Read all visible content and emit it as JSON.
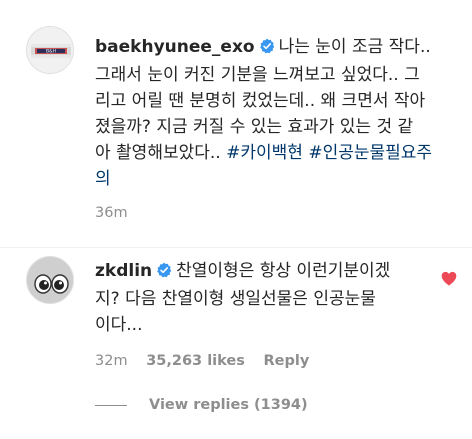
{
  "comments": [
    {
      "username": "baekhyunee_exo",
      "verified": true,
      "avatar_text": "B&H",
      "text_lines": [
        "나는 눈이 조금 작다..",
        "그래서 눈이 커진 기분을 느껴보고 싶었다.. 그",
        "리고 어릴 땐 분명히 컸었는데.. 왜 크면서 작아",
        "졌을까? 지금 커질 수 있는 효과가 있는 것 같",
        "아 촬영해보았다.. "
      ],
      "hashtags": [
        "#카이백현",
        "#인공눈물필요주",
        "의"
      ],
      "time": "36m"
    },
    {
      "username": "zkdlin",
      "verified": true,
      "text_lines": [
        "찬열이형은 항상 이런기분이겠",
        "지? 다음 찬열이형 생일선물은 인공눈물",
        "이다..."
      ],
      "time": "32m",
      "likes": "35,263 likes",
      "reply_label": "Reply",
      "liked": true,
      "view_replies": "View replies (1394)"
    }
  ],
  "colors": {
    "text": "#262626",
    "muted": "#8e8e8e",
    "hashtag": "#00376b",
    "verified": "#3897f0",
    "heart": "#ed4956"
  }
}
